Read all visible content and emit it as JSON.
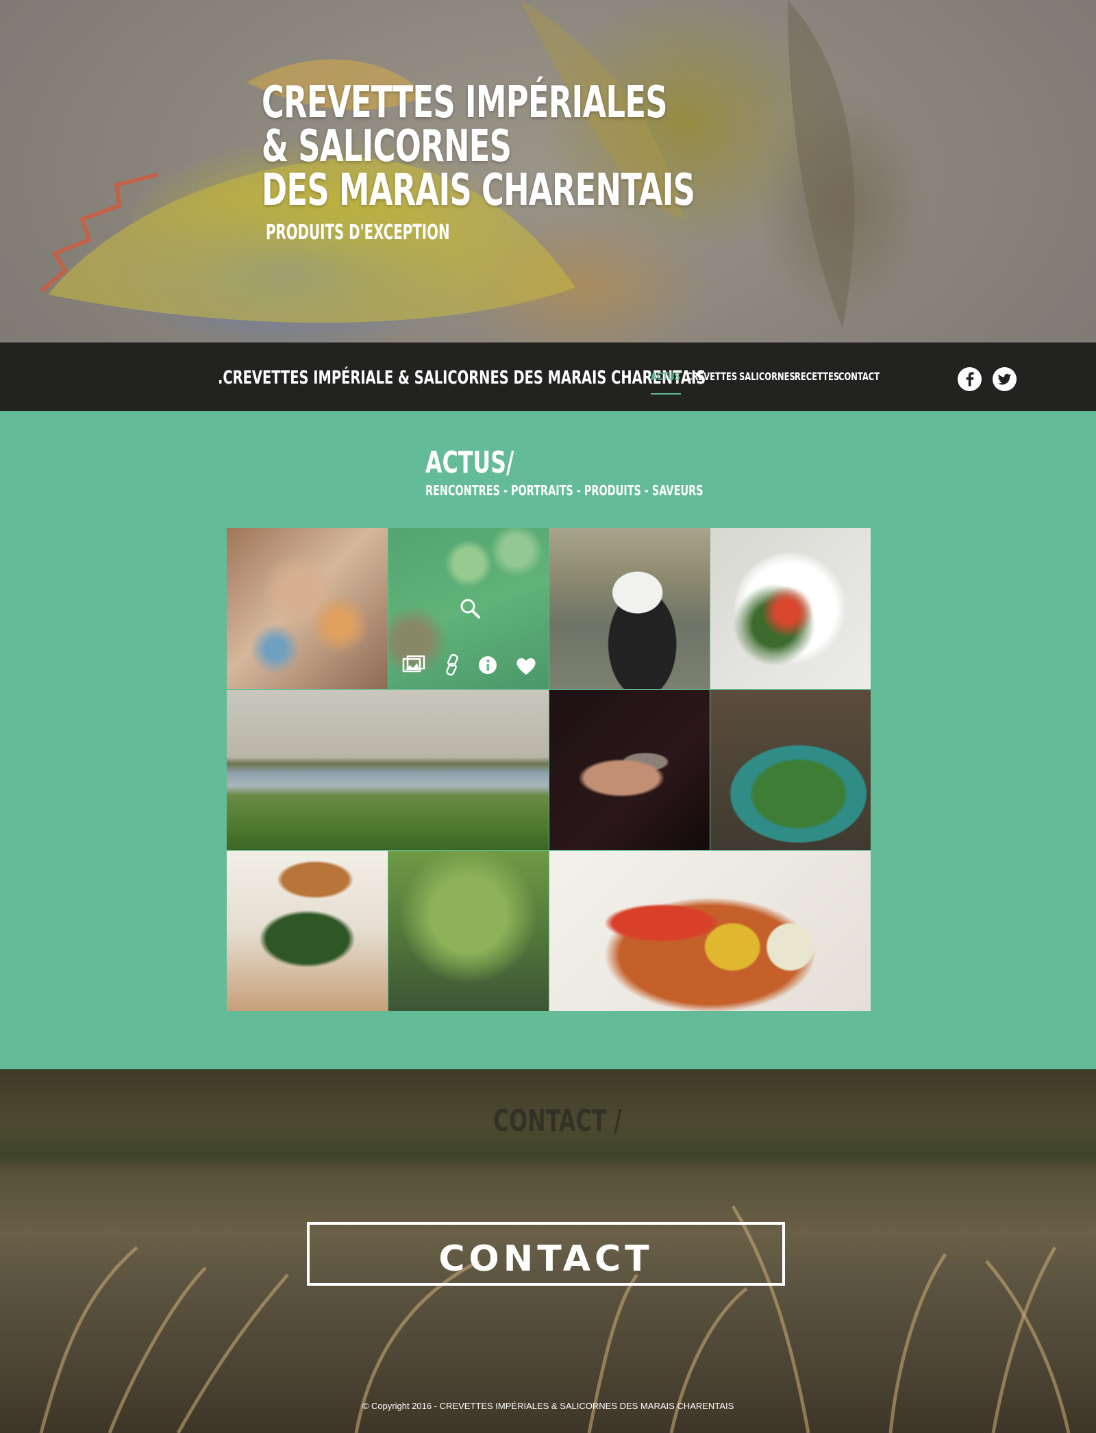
{
  "hero": {
    "title_lines": [
      "CREVETTES IMPÉRIALES",
      "& SALICORNES",
      "DES MARAIS CHARENTAIS"
    ],
    "subtitle": "PRODUITS D'EXCEPTION"
  },
  "nav": {
    "brand": ".CREVETTES IMPÉRIALE & SALICORNES DES MARAIS CHARENTAIS",
    "items": [
      {
        "label": "ACTUS",
        "active": true
      },
      {
        "label": "CREVETTES"
      },
      {
        "label": "SALICORNES"
      },
      {
        "label": "RECETTES"
      },
      {
        "label": "CONTACT"
      }
    ],
    "social": [
      "facebook-icon",
      "twitter-icon"
    ],
    "accent_color": "#62ba96"
  },
  "actus": {
    "title": "ACTUS/",
    "subtitle": "RENCONTRES - PORTRAITS - PRODUITS - SAVEURS",
    "background_color": "#63bb97",
    "gallery_hover_icons": [
      "zoom-icon",
      "gallery-icon",
      "link-icon",
      "info-icon",
      "heart-icon"
    ]
  },
  "contact": {
    "heading": "CONTACT /",
    "button_label": "CONTACT"
  },
  "footer": {
    "copyright": "© Copyright 2016 - CREVETTES IMPÉRIALES & SALICORNES DES MARAIS CHARENTAIS"
  }
}
